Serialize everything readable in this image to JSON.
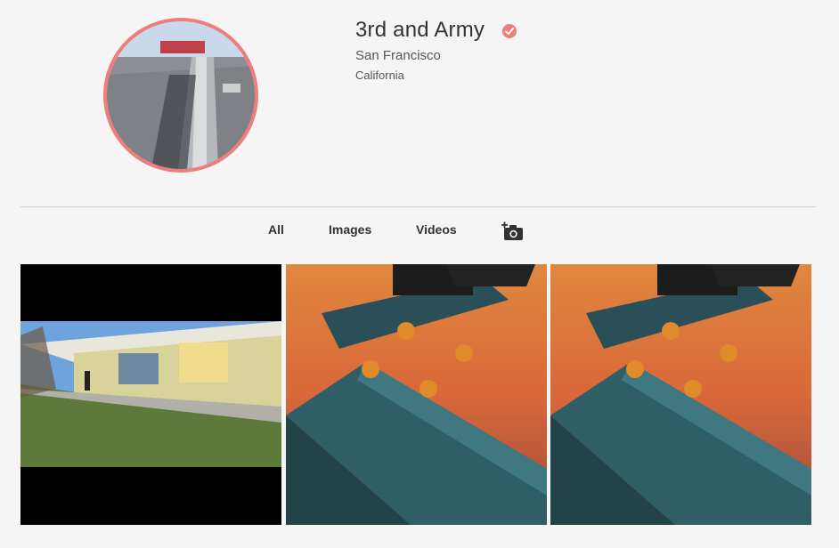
{
  "profile": {
    "name": "3rd and Army",
    "city": "San Francisco",
    "state": "California",
    "verified_icon": "verified-check-icon",
    "accent_color": "#f07c7c"
  },
  "tabs": [
    {
      "label": "All"
    },
    {
      "label": "Images"
    },
    {
      "label": "Videos"
    }
  ],
  "add_photo_icon": "add-photo-camera-icon",
  "gallery": [
    {
      "type": "video",
      "subject": "skater-building"
    },
    {
      "type": "image",
      "subject": "skateboard-ledge"
    },
    {
      "type": "image",
      "subject": "skateboard-ledge"
    }
  ]
}
